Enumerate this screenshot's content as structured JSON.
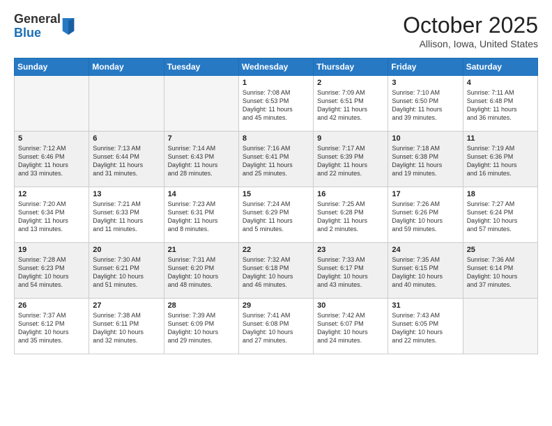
{
  "header": {
    "logo_general": "General",
    "logo_blue": "Blue",
    "month_title": "October 2025",
    "location": "Allison, Iowa, United States"
  },
  "days_of_week": [
    "Sunday",
    "Monday",
    "Tuesday",
    "Wednesday",
    "Thursday",
    "Friday",
    "Saturday"
  ],
  "weeks": [
    [
      {
        "day": "",
        "info": ""
      },
      {
        "day": "",
        "info": ""
      },
      {
        "day": "",
        "info": ""
      },
      {
        "day": "1",
        "info": "Sunrise: 7:08 AM\nSunset: 6:53 PM\nDaylight: 11 hours\nand 45 minutes."
      },
      {
        "day": "2",
        "info": "Sunrise: 7:09 AM\nSunset: 6:51 PM\nDaylight: 11 hours\nand 42 minutes."
      },
      {
        "day": "3",
        "info": "Sunrise: 7:10 AM\nSunset: 6:50 PM\nDaylight: 11 hours\nand 39 minutes."
      },
      {
        "day": "4",
        "info": "Sunrise: 7:11 AM\nSunset: 6:48 PM\nDaylight: 11 hours\nand 36 minutes."
      }
    ],
    [
      {
        "day": "5",
        "info": "Sunrise: 7:12 AM\nSunset: 6:46 PM\nDaylight: 11 hours\nand 33 minutes."
      },
      {
        "day": "6",
        "info": "Sunrise: 7:13 AM\nSunset: 6:44 PM\nDaylight: 11 hours\nand 31 minutes."
      },
      {
        "day": "7",
        "info": "Sunrise: 7:14 AM\nSunset: 6:43 PM\nDaylight: 11 hours\nand 28 minutes."
      },
      {
        "day": "8",
        "info": "Sunrise: 7:16 AM\nSunset: 6:41 PM\nDaylight: 11 hours\nand 25 minutes."
      },
      {
        "day": "9",
        "info": "Sunrise: 7:17 AM\nSunset: 6:39 PM\nDaylight: 11 hours\nand 22 minutes."
      },
      {
        "day": "10",
        "info": "Sunrise: 7:18 AM\nSunset: 6:38 PM\nDaylight: 11 hours\nand 19 minutes."
      },
      {
        "day": "11",
        "info": "Sunrise: 7:19 AM\nSunset: 6:36 PM\nDaylight: 11 hours\nand 16 minutes."
      }
    ],
    [
      {
        "day": "12",
        "info": "Sunrise: 7:20 AM\nSunset: 6:34 PM\nDaylight: 11 hours\nand 13 minutes."
      },
      {
        "day": "13",
        "info": "Sunrise: 7:21 AM\nSunset: 6:33 PM\nDaylight: 11 hours\nand 11 minutes."
      },
      {
        "day": "14",
        "info": "Sunrise: 7:23 AM\nSunset: 6:31 PM\nDaylight: 11 hours\nand 8 minutes."
      },
      {
        "day": "15",
        "info": "Sunrise: 7:24 AM\nSunset: 6:29 PM\nDaylight: 11 hours\nand 5 minutes."
      },
      {
        "day": "16",
        "info": "Sunrise: 7:25 AM\nSunset: 6:28 PM\nDaylight: 11 hours\nand 2 minutes."
      },
      {
        "day": "17",
        "info": "Sunrise: 7:26 AM\nSunset: 6:26 PM\nDaylight: 10 hours\nand 59 minutes."
      },
      {
        "day": "18",
        "info": "Sunrise: 7:27 AM\nSunset: 6:24 PM\nDaylight: 10 hours\nand 57 minutes."
      }
    ],
    [
      {
        "day": "19",
        "info": "Sunrise: 7:28 AM\nSunset: 6:23 PM\nDaylight: 10 hours\nand 54 minutes."
      },
      {
        "day": "20",
        "info": "Sunrise: 7:30 AM\nSunset: 6:21 PM\nDaylight: 10 hours\nand 51 minutes."
      },
      {
        "day": "21",
        "info": "Sunrise: 7:31 AM\nSunset: 6:20 PM\nDaylight: 10 hours\nand 48 minutes."
      },
      {
        "day": "22",
        "info": "Sunrise: 7:32 AM\nSunset: 6:18 PM\nDaylight: 10 hours\nand 46 minutes."
      },
      {
        "day": "23",
        "info": "Sunrise: 7:33 AM\nSunset: 6:17 PM\nDaylight: 10 hours\nand 43 minutes."
      },
      {
        "day": "24",
        "info": "Sunrise: 7:35 AM\nSunset: 6:15 PM\nDaylight: 10 hours\nand 40 minutes."
      },
      {
        "day": "25",
        "info": "Sunrise: 7:36 AM\nSunset: 6:14 PM\nDaylight: 10 hours\nand 37 minutes."
      }
    ],
    [
      {
        "day": "26",
        "info": "Sunrise: 7:37 AM\nSunset: 6:12 PM\nDaylight: 10 hours\nand 35 minutes."
      },
      {
        "day": "27",
        "info": "Sunrise: 7:38 AM\nSunset: 6:11 PM\nDaylight: 10 hours\nand 32 minutes."
      },
      {
        "day": "28",
        "info": "Sunrise: 7:39 AM\nSunset: 6:09 PM\nDaylight: 10 hours\nand 29 minutes."
      },
      {
        "day": "29",
        "info": "Sunrise: 7:41 AM\nSunset: 6:08 PM\nDaylight: 10 hours\nand 27 minutes."
      },
      {
        "day": "30",
        "info": "Sunrise: 7:42 AM\nSunset: 6:07 PM\nDaylight: 10 hours\nand 24 minutes."
      },
      {
        "day": "31",
        "info": "Sunrise: 7:43 AM\nSunset: 6:05 PM\nDaylight: 10 hours\nand 22 minutes."
      },
      {
        "day": "",
        "info": ""
      }
    ]
  ]
}
